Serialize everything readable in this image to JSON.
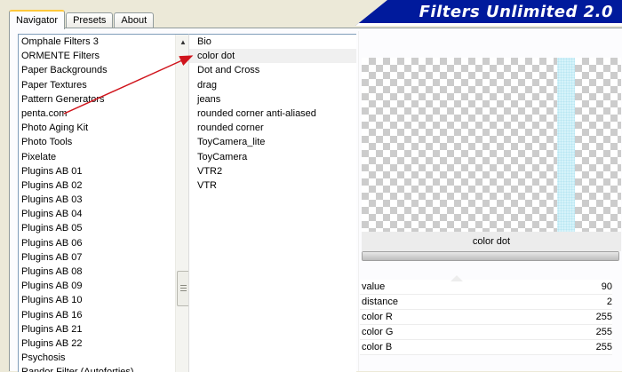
{
  "tabs": [
    {
      "label": "Navigator",
      "active": true
    },
    {
      "label": "Presets",
      "active": false
    },
    {
      "label": "About",
      "active": false
    }
  ],
  "logo": {
    "text": "Filters Unlimited 2.0"
  },
  "categories": [
    "Omphale Filters 3",
    "ORMENTE Filters",
    "Paper Backgrounds",
    "Paper Textures",
    "Pattern Generators",
    "penta.com",
    "Photo Aging Kit",
    "Photo Tools",
    "Pixelate",
    "Plugins AB 01",
    "Plugins AB 02",
    "Plugins AB 03",
    "Plugins AB 04",
    "Plugins AB 05",
    "Plugins AB 06",
    "Plugins AB 07",
    "Plugins AB 08",
    "Plugins AB 09",
    "Plugins AB 10",
    "Plugins AB 16",
    "Plugins AB 21",
    "Plugins AB 22",
    "Psychosis",
    "Randor Filter (Autoforties)"
  ],
  "filters": [
    "Bio",
    "color dot",
    "Dot and Cross",
    "drag",
    "jeans",
    "rounded corner anti-aliased",
    "rounded corner",
    "ToyCamera_lite",
    "ToyCamera",
    "VTR2",
    "VTR"
  ],
  "selected_filter": "color dot",
  "filter_name": "color dot",
  "progress": 1.0,
  "params": [
    {
      "label": "value",
      "value": "90"
    },
    {
      "label": "distance",
      "value": "2"
    },
    {
      "label": "color R",
      "value": "255"
    },
    {
      "label": "color G",
      "value": "255"
    },
    {
      "label": "color B",
      "value": "255"
    }
  ],
  "colors": {
    "logo_bg": "#001a9c",
    "annotation_arrow": "#d0141c",
    "preview_stripe": "#d6f3fa",
    "active_tab_accent": "#ffc83c"
  }
}
